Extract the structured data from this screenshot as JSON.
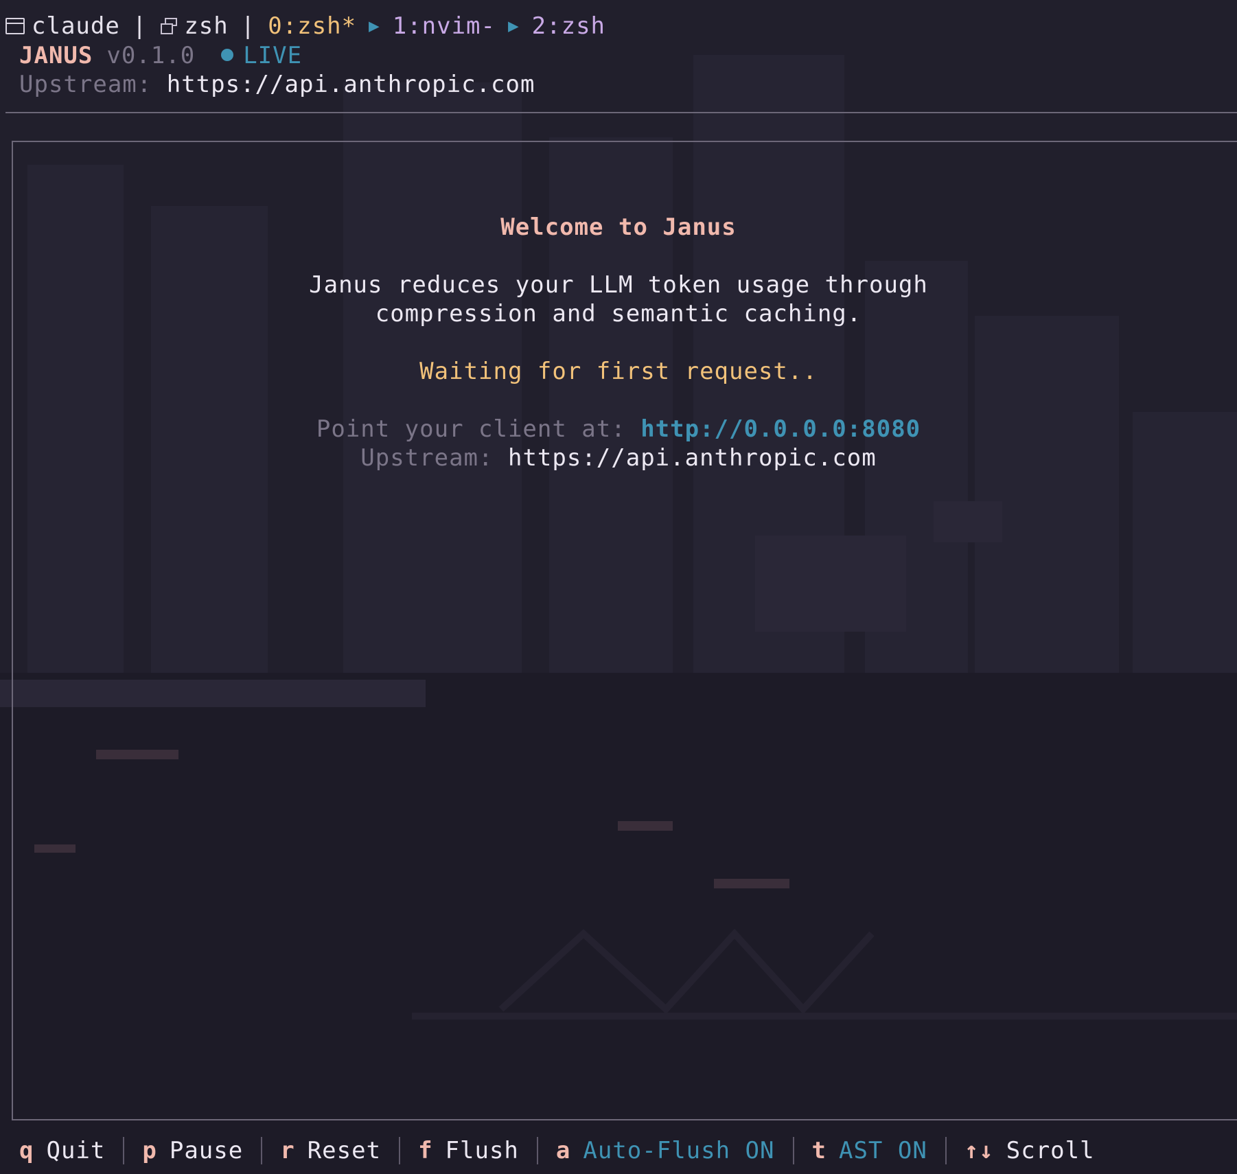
{
  "tmux": {
    "session": "claude",
    "windows": [
      {
        "label": "zsh"
      },
      {
        "label": "0:zsh*"
      },
      {
        "label": "1:nvim-"
      },
      {
        "label": "2:zsh"
      }
    ],
    "separator": "|"
  },
  "header": {
    "brand": "JANUS",
    "version": "v0.1.0",
    "status": "LIVE",
    "upstream_label": "Upstream:",
    "upstream_url": "https://api.anthropic.com"
  },
  "welcome": {
    "title": "Welcome to Janus",
    "description_line1": "Janus reduces your LLM token usage through",
    "description_line2": "compression and semantic caching.",
    "waiting": "Waiting for first request..",
    "point_label": "Point your client at:",
    "point_url": "http://0.0.0.0:8080",
    "upstream_label": "Upstream:",
    "upstream_url": "https://api.anthropic.com"
  },
  "footer": {
    "items": [
      {
        "key": "q",
        "label": "Quit"
      },
      {
        "key": "p",
        "label": "Pause"
      },
      {
        "key": "r",
        "label": "Reset"
      },
      {
        "key": "f",
        "label": "Flush"
      },
      {
        "key": "a",
        "label": "Auto-Flush ON"
      },
      {
        "key": "t",
        "label": "AST ON"
      },
      {
        "key": "↑↓",
        "label": "Scroll"
      }
    ]
  },
  "colors": {
    "background": "#211f2c",
    "accent_pink": "#f1b9ad",
    "accent_yellow": "#f2c27a",
    "accent_blue": "#3f93b4",
    "accent_purple": "#c9a9e6",
    "muted": "#7b7588"
  }
}
